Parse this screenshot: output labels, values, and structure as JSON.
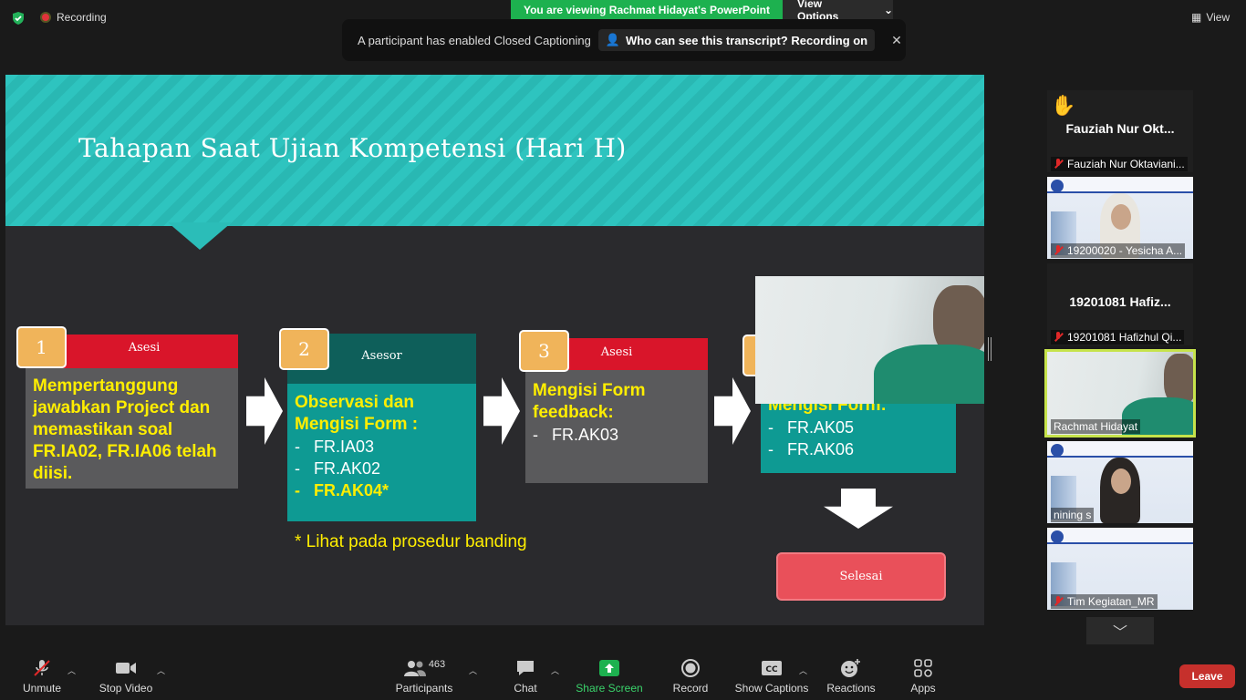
{
  "topbar": {
    "recording_label": "Recording",
    "viewing_label": "You are viewing Rachmat Hidayat's PowerPoint",
    "view_options_label": "View Options",
    "cc_message": "A participant has enabled Closed Captioning",
    "cc_link": "Who can see this transcript? Recording on",
    "view_label": "View"
  },
  "slide": {
    "title": "Tahapan Saat Ujian Kompetensi (Hari H)",
    "steps": [
      {
        "num": "1",
        "role": "Asesi",
        "lines": [
          "Mempertanggung",
          "jawabkan Project dan",
          "memastikan soal",
          "FR.IA02, FR.IA06 telah",
          "diisi."
        ]
      },
      {
        "num": "2",
        "role": "Asesor",
        "heading": [
          "Observasi dan",
          "Mengisi Form :"
        ],
        "items": [
          "FR.IA03",
          "FR.AK02",
          "FR.AK04*"
        ]
      },
      {
        "num": "3",
        "role": "Asesi",
        "heading": [
          "Mengisi Form",
          "feedback:"
        ],
        "items": [
          "FR.AK03"
        ]
      },
      {
        "heading_partial": "Mengisi Form:",
        "items": [
          "FR.AK05",
          "FR.AK06"
        ]
      }
    ],
    "note": "* Lihat pada prosedur banding",
    "finish_label": "Selesai"
  },
  "participants": [
    {
      "big_name": "Fauziah Nur Okt...",
      "name": "Fauziah Nur Oktaviani...",
      "raised_hand": true
    },
    {
      "name": "19200020 - Yesicha A...",
      "video": true
    },
    {
      "big_name": "19201081 Hafiz...",
      "name": "19201081 Hafizhul Qi..."
    },
    {
      "name": "Rachmat Hidayat",
      "video": true,
      "active_speaker": true
    },
    {
      "name": "nining s",
      "video": true
    },
    {
      "name": "Tim Kegiatan_MR",
      "video": true
    }
  ],
  "toolbar": {
    "unmute": "Unmute",
    "stop_video": "Stop Video",
    "participants": "Participants",
    "participants_count": "463",
    "chat": "Chat",
    "share_screen": "Share Screen",
    "record": "Record",
    "show_captions": "Show Captions",
    "reactions": "Reactions",
    "apps": "Apps",
    "leave": "Leave"
  },
  "colors": {
    "share_green": "#1db14f",
    "slide_teal": "#2ec4bf",
    "leave_red": "#c6302c",
    "accent_yellow": "#ffee00"
  }
}
